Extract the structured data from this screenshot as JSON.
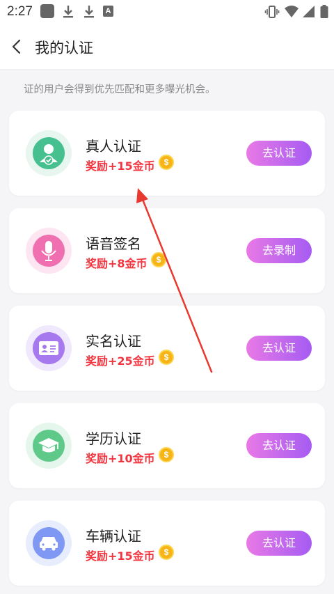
{
  "status_bar": {
    "time": "2:27",
    "a_label": "A",
    "icons": [
      "square-notification-icon",
      "download-icon",
      "download-icon",
      "a-icon",
      "vibrate-icon",
      "wifi-icon",
      "signal-icon",
      "battery-icon"
    ]
  },
  "header": {
    "title": "我的认证",
    "back_icon": "chevron-left-icon"
  },
  "hint": "证的用户会得到优先匹配和更多曝光机会。",
  "cards": [
    {
      "title": "真人认证",
      "reward": "奖励+15金币",
      "button": "去认证",
      "icon": "person-verified-icon",
      "color": "#45c08e",
      "bg": "#e7f6ef"
    },
    {
      "title": "语音签名",
      "reward": "奖励+8金币",
      "button": "去录制",
      "icon": "microphone-icon",
      "color": "#f06fb0",
      "bg": "#fde6f1"
    },
    {
      "title": "实名认证",
      "reward": "奖励+25金币",
      "button": "去认证",
      "icon": "id-card-icon",
      "color": "#a679ee",
      "bg": "#f0e8fc"
    },
    {
      "title": "学历认证",
      "reward": "奖励+10金币",
      "button": "去认证",
      "icon": "graduation-cap-icon",
      "color": "#5fc98a",
      "bg": "#e5f6ec"
    },
    {
      "title": "车辆认证",
      "reward": "奖励+15金币",
      "button": "去认证",
      "icon": "car-icon",
      "color": "#7f98f3",
      "bg": "#e8edfd"
    }
  ],
  "coin_symbol": "$",
  "annotation": {
    "color": "#e8382f",
    "icon": "red-arrow-annotation"
  }
}
